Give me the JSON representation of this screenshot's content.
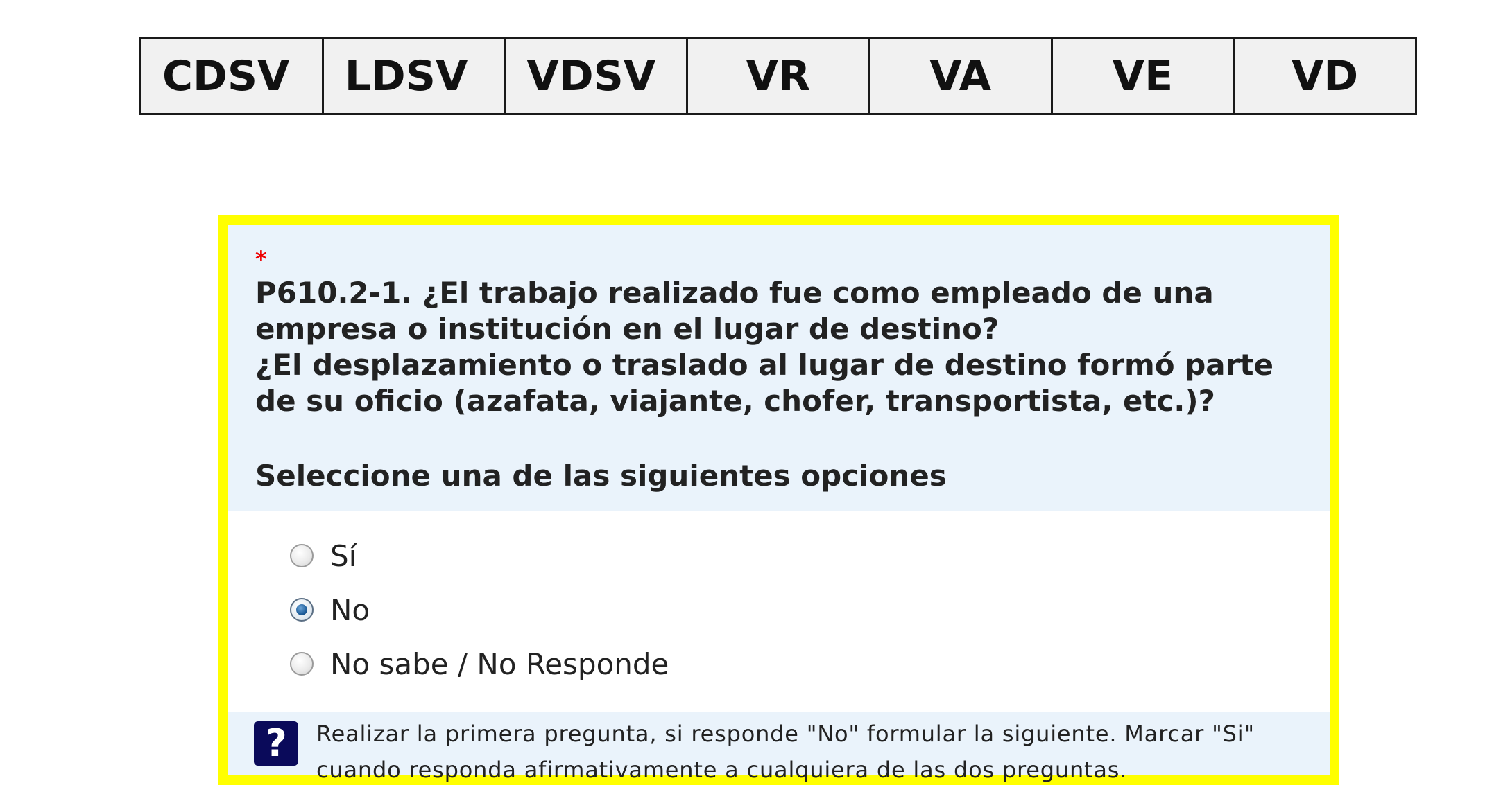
{
  "tabs": [
    "CDSV",
    "LDSV",
    "VDSV",
    "VR",
    "VA",
    "VE",
    "VD"
  ],
  "question": {
    "required_mark": "*",
    "line1": "P610.2-1. ¿El trabajo realizado fue como empleado de una empresa o institución en el lugar de destino?",
    "line2": "¿El desplazamiento o traslado al lugar de destino formó parte de su oficio (azafata, viajante, chofer, transportista, etc.)?",
    "instruction": "Seleccione una de las siguientes opciones"
  },
  "options": [
    {
      "label": "Sí",
      "checked": false
    },
    {
      "label": "No",
      "checked": true
    },
    {
      "label": "No sabe / No Responde",
      "checked": false
    }
  ],
  "help": {
    "icon": "?",
    "text": "Realizar la primera pregunta, si responde \"No\" formular la siguiente. Marcar \"Si\" cuando responda afirmativamente a cualquiera de las dos preguntas."
  },
  "colors": {
    "highlight_border": "#ffff00",
    "question_background": "#eaf3fb",
    "required": "#ee0000",
    "help_icon": "#0a0a5a"
  }
}
